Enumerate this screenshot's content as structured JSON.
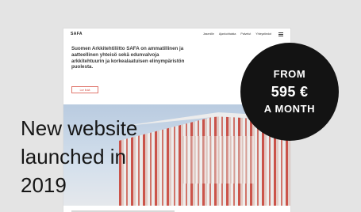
{
  "preview": {
    "site_logo": "SAFA",
    "nav_links": [
      "Jasenille",
      "Ajankohtaista",
      "Palvelut",
      "Yhteystiedot"
    ],
    "headline": "Suomen Arkkitehtiliitto SAFA on ammatillinen ja aatteellinen yhteisö sekä edunvalvoja arkkitehtuurin ja korkealaatuisen elinympäristön puolesta.",
    "cta_label": "Lue lisää",
    "hero_icon": "building-photo"
  },
  "badge": {
    "line1": "FROM",
    "line2": "595 €",
    "line3": "A MONTH",
    "color": "#131313"
  },
  "promo": {
    "line1": "New website",
    "line2": "launched in",
    "line3": "2019"
  },
  "colors": {
    "background": "#e4e4e4",
    "accent": "#d5564d"
  }
}
